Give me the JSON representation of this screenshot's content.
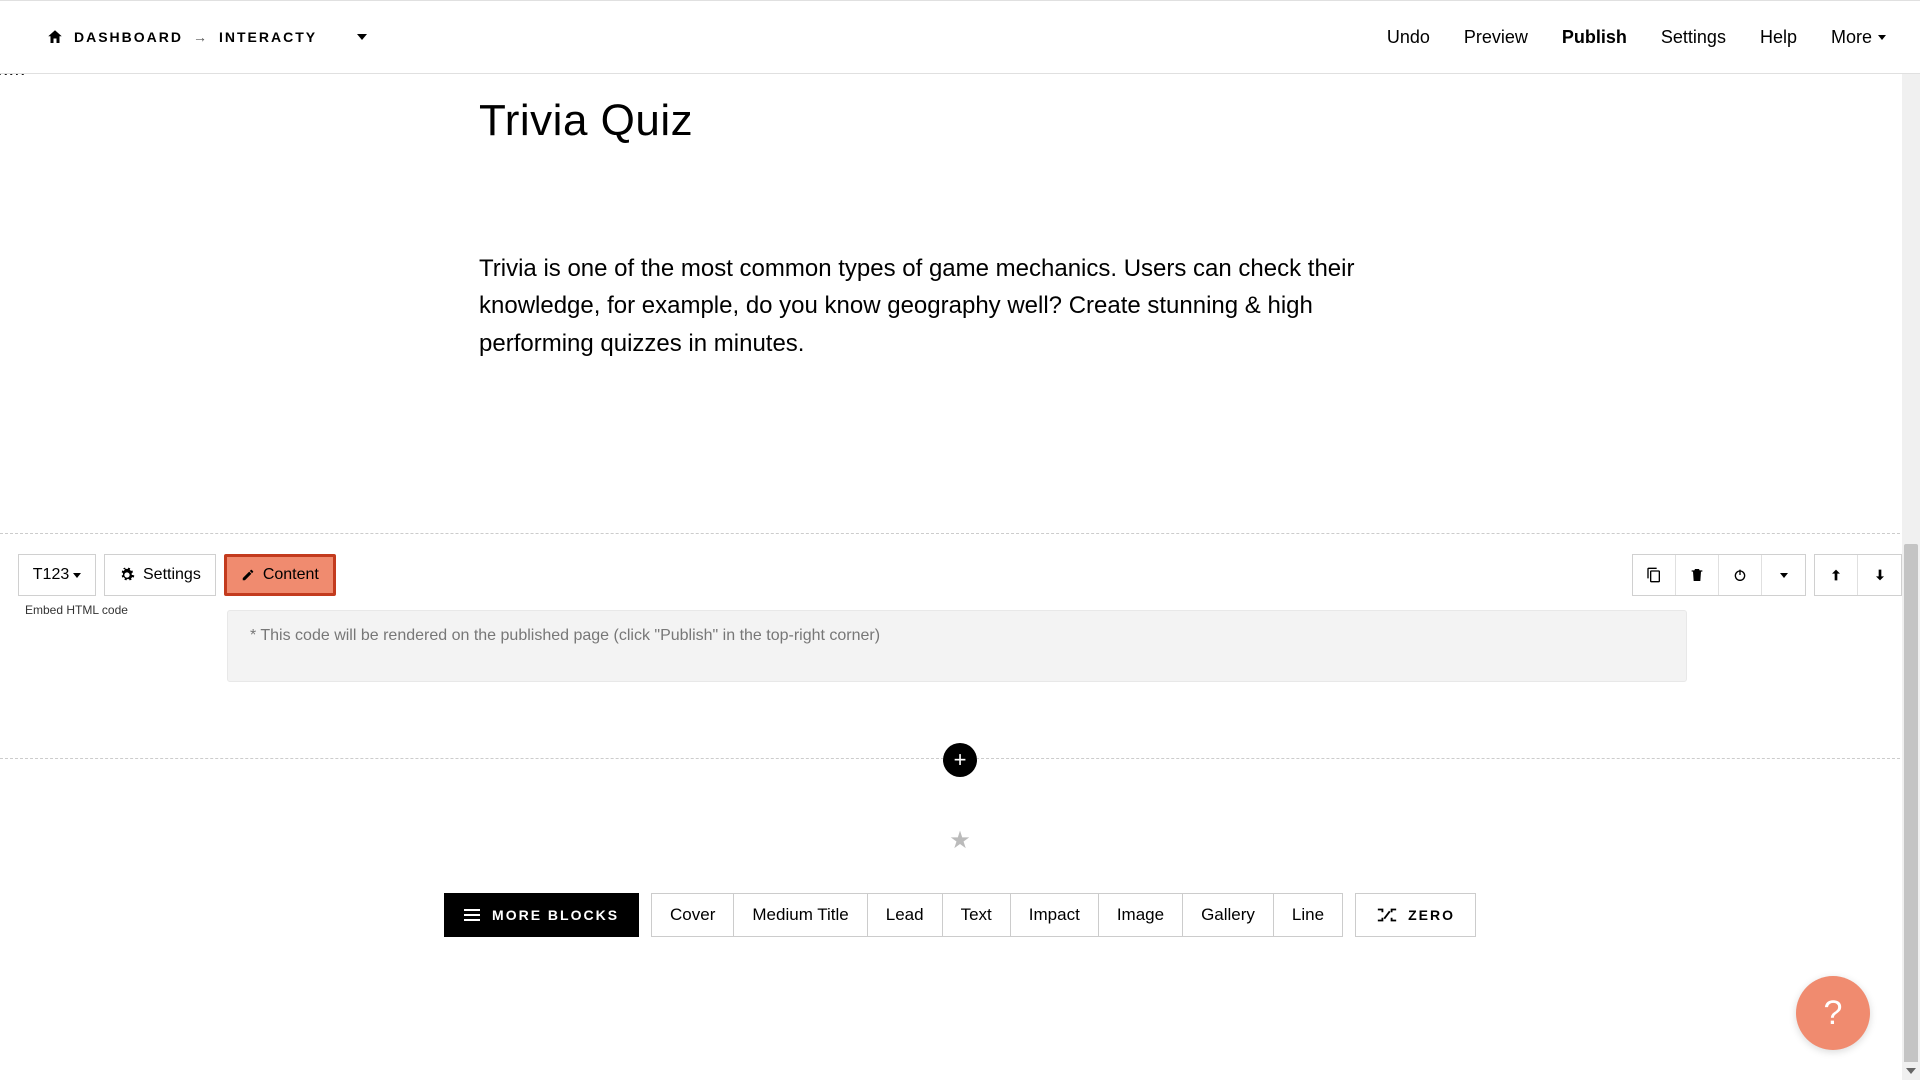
{
  "breadcrumb": {
    "dashboard": "DASHBOARD",
    "project": "INTERACTY"
  },
  "topbar": {
    "undo": "Undo",
    "preview": "Preview",
    "publish": "Publish",
    "settings": "Settings",
    "help": "Help",
    "more": "More"
  },
  "page": {
    "title": "Trivia Quiz",
    "paragraph": "Trivia is one of the most common types of game mechanics. Users can check their knowledge, for example, do you know geography well? Create stunning & high performing quizzes in minutes."
  },
  "editor": {
    "t123": "T123",
    "settings": "Settings",
    "content": "Content",
    "embed_label": "Embed HTML code",
    "code_placeholder": "* This code will be rendered on the published page (click \"Publish\" in the top-right corner)"
  },
  "blocks": {
    "more": "MORE BLOCKS",
    "items": [
      "Cover",
      "Medium Title",
      "Lead",
      "Text",
      "Impact",
      "Image",
      "Gallery",
      "Line"
    ],
    "zero": "ZERO"
  },
  "help": "?"
}
